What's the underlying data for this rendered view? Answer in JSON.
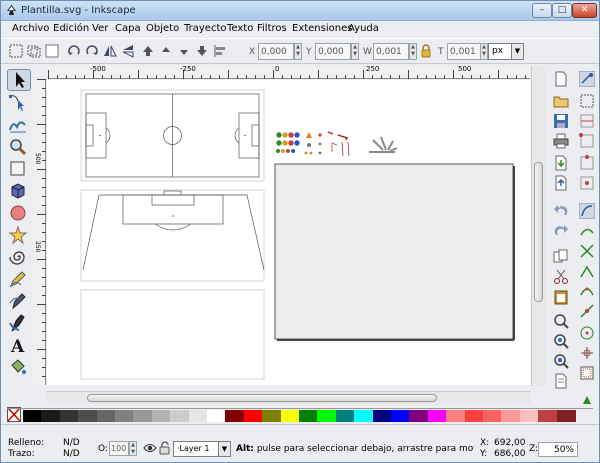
{
  "window": {
    "title": "Plantilla.svg - Inkscape",
    "minimize_glyph": "–",
    "maximize_glyph": "□",
    "close_glyph": "✕"
  },
  "menu": {
    "items": [
      "Archivo",
      "Edición",
      "Ver",
      "Capa",
      "Objeto",
      "Trayecto",
      "Texto",
      "Filtros",
      "Extensiones",
      "Ayuda"
    ]
  },
  "toolbar": {
    "x_label": "X",
    "x_value": "0,000",
    "y_label": "Y",
    "y_value": "0,000",
    "w_label": "W",
    "w_value": "0,001",
    "h_label": "T",
    "h_value": "0,001",
    "unit": "px"
  },
  "rulers": {
    "h_ticks": [
      "-500",
      "-250",
      "0",
      "250",
      "500"
    ],
    "v_ticks": [
      "500",
      "250"
    ]
  },
  "colors": {
    "accent": "#3a6ea5",
    "palette": [
      "#000000",
      "#1a1a1a",
      "#333333",
      "#4d4d4d",
      "#666666",
      "#808080",
      "#999999",
      "#b3b3b3",
      "#cccccc",
      "#e6e6e6",
      "#ffffff",
      "#800000",
      "#ff0000",
      "#808000",
      "#ffff00",
      "#008000",
      "#00ff00",
      "#008080",
      "#00ffff",
      "#000080",
      "#0000ff",
      "#800080",
      "#ff00ff",
      "#ff8080",
      "#ff4040",
      "#ff6060",
      "#ff9999",
      "#ffbfbf",
      "#bf4040",
      "#802020"
    ]
  },
  "status": {
    "fill_label": "Relleno:",
    "fill_value": "N/D",
    "stroke_label": "Trazo:",
    "stroke_value": "N/D",
    "opacity_label": "O:",
    "opacity_value": "100",
    "layer": "·Layer 1",
    "message_bold": "Alt:",
    "message": " pulse para seleccionar debajo, arrastre para mover la selecc",
    "x_label": "X:",
    "x_value": "692,00",
    "y_label": "Y:",
    "y_value": "686,00",
    "zoom_label": "Z:",
    "zoom_value": "50%"
  }
}
